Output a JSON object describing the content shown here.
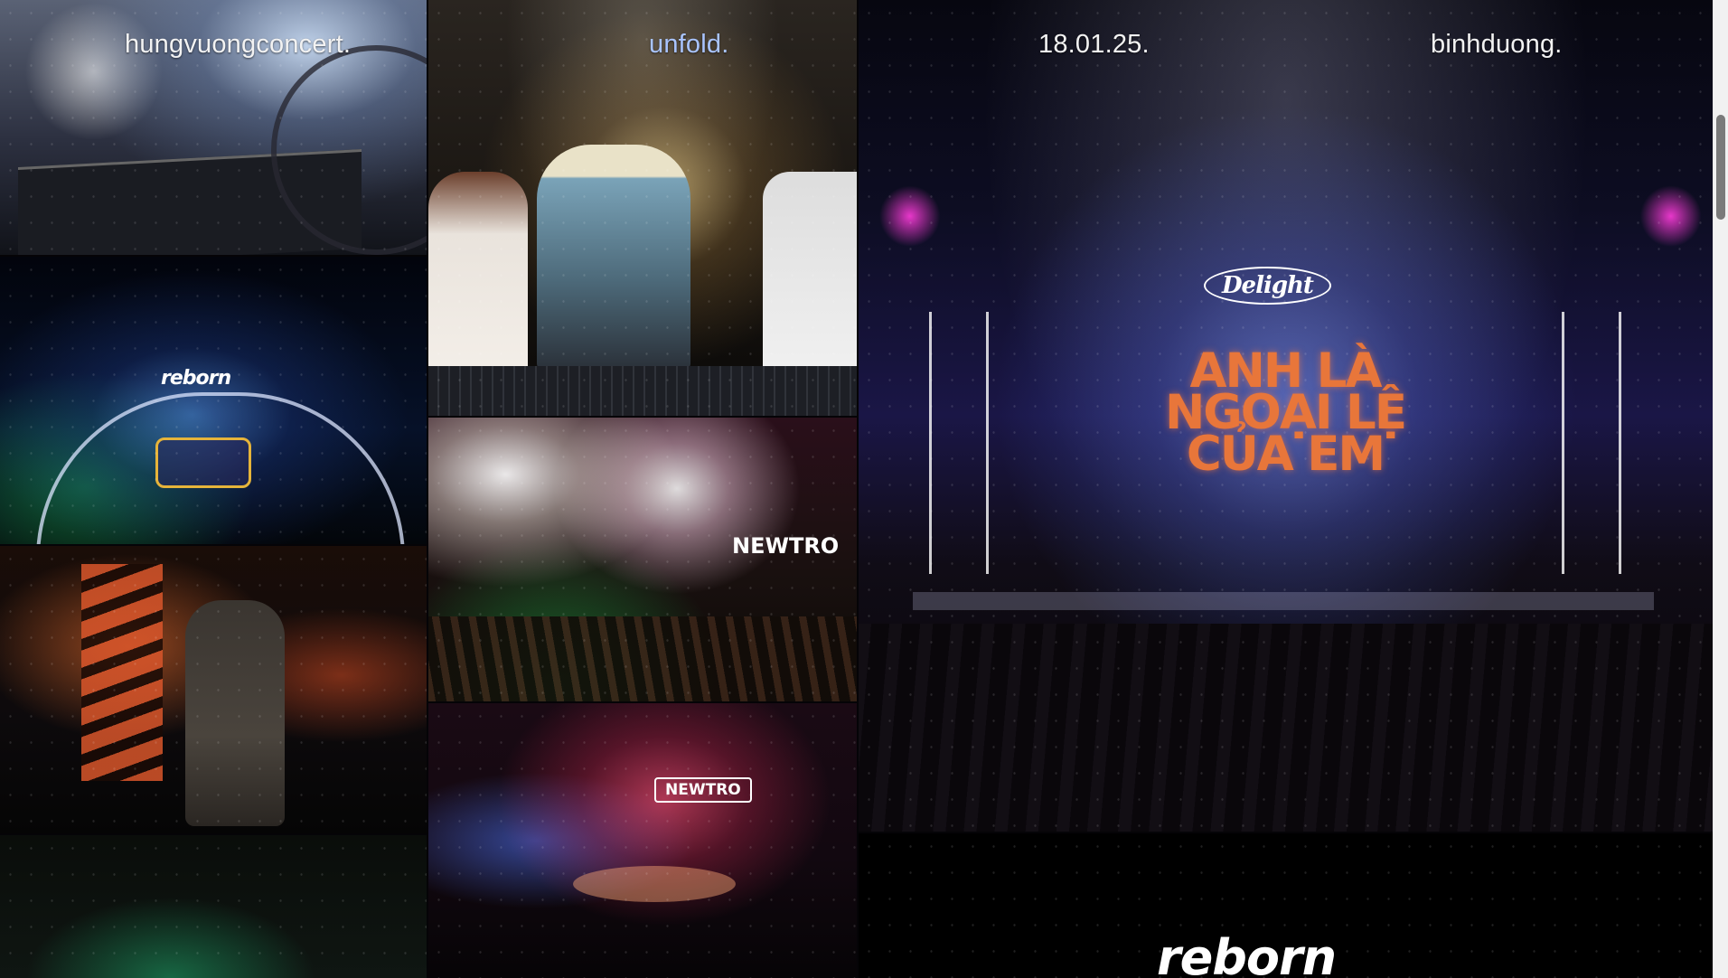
{
  "nav": {
    "artist": "hungvuongconcert.",
    "project": "unfold.",
    "date": "18.01.25.",
    "location": "binhduong."
  },
  "gallery": {
    "stage_logo_reborn": "reborn",
    "sponsor_logo": "Delight",
    "show_title_line1": "ANH LÀ",
    "show_title_line2": "NGOẠI LỆ",
    "show_title_line3": "CỦA EM",
    "stage_sign_newtro": "NEWTRO",
    "footer_logo": "reborn"
  },
  "colors": {
    "background": "#000000",
    "nav_text": "#f2f2f2",
    "nav_accent": "#a9c4ff"
  }
}
